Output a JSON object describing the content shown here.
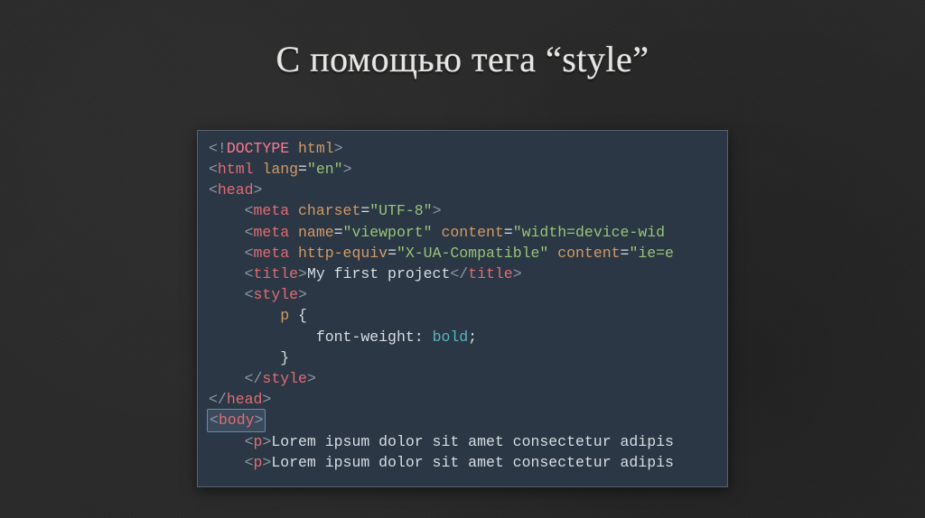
{
  "title": "С помощью тега “style”",
  "code": {
    "doctype_kw": "DOCTYPE",
    "doctype_val": "html",
    "html_tag": "html",
    "lang_attr": "lang",
    "lang_val": "en",
    "head_tag": "head",
    "meta_tag": "meta",
    "charset_attr": "charset",
    "charset_val": "UTF-8",
    "name_attr": "name",
    "viewport_val": "viewport",
    "content_attr": "content",
    "viewport_content": "width=device-wid",
    "httpequiv_attr": "http-equiv",
    "httpequiv_val": "X-UA-Compatible",
    "ie_content": "ie=e",
    "title_tag": "title",
    "title_text": "My first project",
    "style_tag": "style",
    "css_sel": "p",
    "css_prop": "font-weight",
    "css_val": "bold",
    "body_tag": "body",
    "p_tag": "p",
    "lorem1": "Lorem ipsum dolor sit amet consectetur adipis",
    "lorem2": "Lorem ipsum dolor sit amet consectetur adipis"
  }
}
